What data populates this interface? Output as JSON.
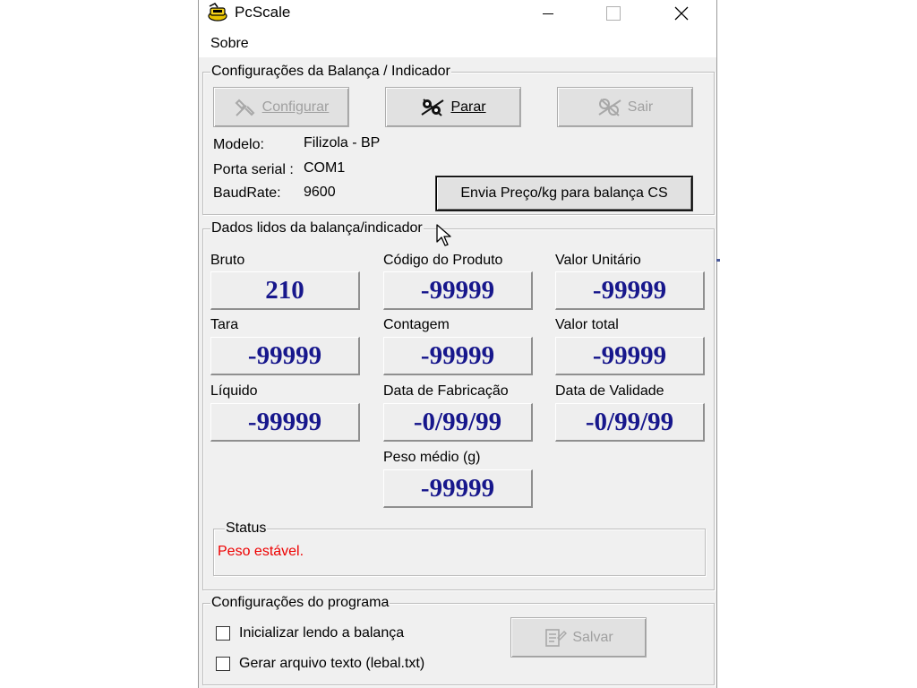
{
  "window": {
    "title": "PcScale",
    "controls": {
      "minimize": "—",
      "maximize": "☐",
      "close": "✕"
    }
  },
  "menu": {
    "items": [
      "Sobre"
    ]
  },
  "config_scale": {
    "legend": "Configurações da Balança / Indicador",
    "buttons": {
      "configure": "Configurar",
      "stop": "Parar",
      "exit": "Sair"
    },
    "fields": [
      {
        "label": "Modelo:",
        "value": "Filizola - BP"
      },
      {
        "label": "Porta serial :",
        "value": "COM1"
      },
      {
        "label": "BaudRate:",
        "value": "9600"
      }
    ],
    "send_price_button": "Envia Preço/kg para balança CS"
  },
  "data_read": {
    "legend": "Dados lidos da balança/indicador",
    "items": [
      {
        "label": "Bruto",
        "value": "210"
      },
      {
        "label": "Código do Produto",
        "value": "-99999"
      },
      {
        "label": "Valor Unitário",
        "value": "-99999"
      },
      {
        "label": "Tara",
        "value": "-99999"
      },
      {
        "label": "Contagem",
        "value": "-99999"
      },
      {
        "label": "Valor total",
        "value": "-99999"
      },
      {
        "label": "Líquido",
        "value": "-99999"
      },
      {
        "label": "Data de Fabricação",
        "value": "-0/99/99"
      },
      {
        "label": "Data de Validade",
        "value": "-0/99/99"
      },
      {
        "label": "Peso médio (g)",
        "value": "-99999"
      }
    ],
    "status": {
      "legend": "Status",
      "text": "Peso estável."
    }
  },
  "program_config": {
    "legend": "Configurações do programa",
    "checkboxes": [
      {
        "label": "Inicializar lendo a balança",
        "checked": false
      },
      {
        "label": "Gerar arquivo texto (lebal.txt)",
        "checked": false
      }
    ],
    "save_button": "Salvar"
  },
  "colors": {
    "value_text": "#17178c",
    "status_text": "#ee0000",
    "window_bg": "#f0f0f0"
  }
}
